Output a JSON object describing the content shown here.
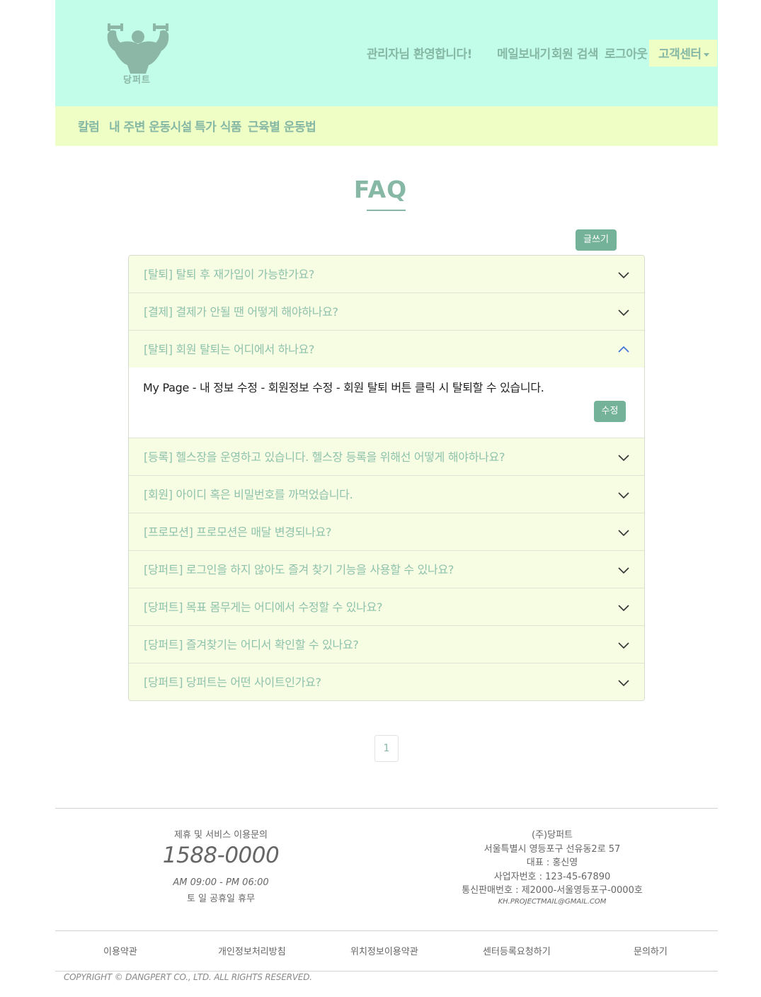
{
  "header": {
    "logo_text": "당퍼트",
    "welcome": "관리자님 환영합니다!",
    "links": [
      "메일보내기",
      "회원 검색",
      "로그아웃"
    ],
    "cs_center": "고객센터"
  },
  "nav": {
    "items": [
      "칼럼",
      "내 주변 운동시설",
      "특가 식품",
      "근육별 운동법"
    ]
  },
  "faq": {
    "title": "FAQ",
    "write_label": "글쓰기",
    "questions": [
      "[탈퇴] 탈퇴 후 재가입이 가능한가요?",
      "[결제] 결제가 안될 땐 어떻게 해야하나요?",
      "[탈퇴] 회원 탈퇴는 어디에서 하나요?",
      "[등록] 헬스장을 운영하고 있습니다. 헬스장 등록을 위해선 어떻게 해야하나요?",
      "[회원] 아이디 혹은 비밀번호를 까먹었습니다.",
      "[프로모션] 프로모션은 매달 변경되나요?",
      "[당퍼트] 로그인을 하지 않아도 즐겨 찾기 기능을 사용할 수 있나요?",
      "[당퍼트] 목표 몸무게는 어디에서 수정할 수 있나요?",
      "[당퍼트] 즐겨찾기는 어디서 확인할 수 있나요?",
      "[당퍼트] 당퍼트는 어떤 사이트인가요?"
    ],
    "expanded_answer": "My Page - 내 정보 수정 - 회원정보 수정 - 회원 탈퇴 버튼 클릭 시 탈퇴할 수 있습니다.",
    "edit_label": "수정"
  },
  "pagination": {
    "current": "1"
  },
  "footer": {
    "contact_label": "제휴 및 서비스 이용문의",
    "phone": "1588-0000",
    "hours": "AM 09:00 - PM 06:00",
    "holiday": "토 일 공휴일 휴무",
    "company": "(주)당퍼트",
    "address": "서울특별시 영등포구 선유동2로 57",
    "ceo": "대표 : 홍신영",
    "biz_no": "사업자번호 : 123-45-67890",
    "mail_order": "통신판매번호 : 제2000-서울영등포구-0000호",
    "email": "KH.PROJECTMAIL@GMAIL.COM",
    "links": [
      "이용약관",
      "개인정보처리방침",
      "위치정보이용약관",
      "센터등록요청하기",
      "문의하기"
    ],
    "copyright": "COPYRIGHT © DANGPERT CO., LTD. ALL RIGHTS RESERVED."
  }
}
